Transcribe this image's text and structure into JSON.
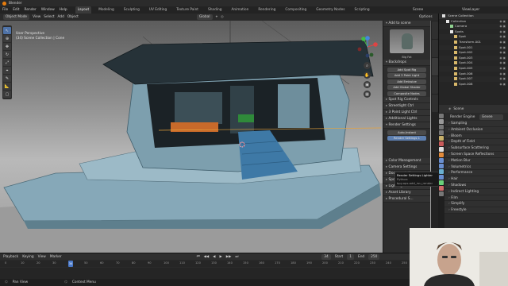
{
  "app": {
    "title": "Blender"
  },
  "menu": {
    "items": [
      "File",
      "Edit",
      "Render",
      "Window",
      "Help"
    ],
    "workspaces": [
      "Layout",
      "Modeling",
      "Sculpting",
      "UV Editing",
      "Texture Paint",
      "Shading",
      "Animation",
      "Rendering",
      "Compositing",
      "Geometry Nodes",
      "Scripting"
    ],
    "active_workspace": "Layout",
    "scene": "Scene",
    "view_layer": "ViewLayer"
  },
  "viewport_header": {
    "mode": "Object Mode",
    "menus": [
      "View",
      "Select",
      "Add",
      "Object"
    ],
    "transform": "Global",
    "options": "Options"
  },
  "viewport": {
    "info_line1": "User Perspective",
    "info_line2": "(34) Scene Collection | Cone"
  },
  "tools": [
    "cursor-tool",
    "move-tool",
    "rotate-tool",
    "scale-tool",
    "transform-tool",
    "annotate-tool",
    "measure-tool",
    "add-cube-tool"
  ],
  "npanel": {
    "add_to_scene": "Add to scene",
    "preview_label": "Big Fat",
    "backdrops": "Backdrops",
    "add_spot_rig": "Add Spot Rig",
    "add_point_light": "Add 3 Point Light",
    "add_emissive": "Add Emissive",
    "add_global_shader": "Add Global Shader",
    "composite_nodes": "Composite Nodes",
    "sections_mid": [
      "Spot Rig Controls",
      "Streetlight Ctrl",
      "3 Point Light Ctrl",
      "Additional Lights",
      "Render Settings"
    ],
    "render_btn1": "Auto-Instant",
    "render_btn2": "Render Settings 1",
    "sections_bottom": [
      "Color Management",
      "Camera Settings",
      "Documentation",
      "Spotlig Light Ctrl",
      "Lighting To HDRI",
      "Asset Library",
      "Procedural S..."
    ]
  },
  "tooltip": {
    "title": "Render Settings Lighter",
    "desc": "Python: bpy.ops.add_rsu_render"
  },
  "outliner": {
    "header": "Scene Collection",
    "rows": [
      {
        "label": "Collection",
        "indent": 1,
        "color": "#e6e6e6"
      },
      {
        "label": "Camera",
        "indent": 2,
        "color": "#8fd18f"
      },
      {
        "label": "Spots",
        "indent": 2,
        "color": "#e6e6e6"
      },
      {
        "label": "Spot",
        "indent": 3,
        "color": "#d8b86a"
      },
      {
        "label": "Transform.001",
        "indent": 3,
        "color": "#d8b86a"
      },
      {
        "label": "Spot.001",
        "indent": 3,
        "color": "#d8b86a"
      },
      {
        "label": "Spot.002",
        "indent": 3,
        "color": "#d8b86a"
      },
      {
        "label": "Spot.003",
        "indent": 3,
        "color": "#d8b86a"
      },
      {
        "label": "Spot.004",
        "indent": 3,
        "color": "#d8b86a"
      },
      {
        "label": "Spot.005",
        "indent": 3,
        "color": "#d8b86a"
      },
      {
        "label": "Spot.006",
        "indent": 3,
        "color": "#d8b86a"
      },
      {
        "label": "Spot.007",
        "indent": 3,
        "color": "#d8b86a"
      },
      {
        "label": "Spot.008",
        "indent": 3,
        "color": "#d8b86a"
      }
    ]
  },
  "properties": {
    "header": "Scene",
    "render_engine_label": "Render Engine",
    "render_engine_value": "Eevee",
    "panels": [
      "Sampling",
      "Ambient Occlusion",
      "Bloom",
      "Depth of Field",
      "Subsurface Scattering",
      "Screen Space Reflections",
      "Motion Blur",
      "Volumetrics",
      "Performance",
      "Hair",
      "Shadows",
      "Indirect Lighting",
      "Film",
      "Simplify",
      "Freestyle"
    ]
  },
  "timeline": {
    "menus": [
      "Playback",
      "Keying",
      "View",
      "Marker"
    ],
    "ticks": [
      "0",
      "10",
      "20",
      "30",
      "40",
      "50",
      "60",
      "70",
      "80",
      "90",
      "100",
      "110",
      "120",
      "130",
      "140",
      "150",
      "160",
      "170",
      "180",
      "190",
      "200",
      "210",
      "220",
      "230",
      "240",
      "250"
    ],
    "current_frame": "34",
    "start_label": "Start",
    "start_value": "1",
    "end_label": "End",
    "end_value": "250"
  },
  "status": {
    "items": [
      "Pan View",
      "Context Menu"
    ]
  },
  "colors": {
    "accent": "#4a79c9",
    "boat_blue": "#7fa2b3",
    "boat_dark": "#3f5d6b"
  }
}
